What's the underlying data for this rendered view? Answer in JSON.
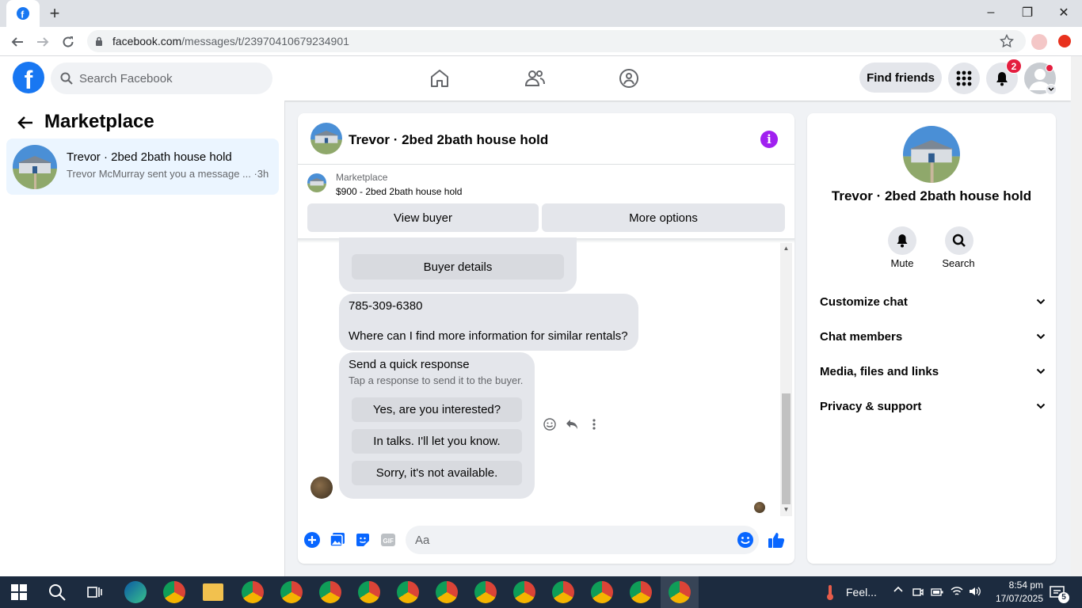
{
  "browser": {
    "url_host": "facebook.com",
    "url_path": "/messages/t/23970410679234901",
    "new_tab": "+",
    "minimize": "–",
    "maximize": "❐",
    "close": "✕"
  },
  "header": {
    "logo": "f",
    "search_placeholder": "Search Facebook",
    "find_friends": "Find friends",
    "notification_count": "2"
  },
  "sidebar": {
    "title": "Marketplace",
    "conversations": [
      {
        "title": "Trevor · 2bed 2bath house hold",
        "preview": "Trevor McMurray sent you a message ... ·3h"
      }
    ]
  },
  "chat": {
    "title": "Trevor · 2bed 2bath house hold",
    "info_icon": "i",
    "listing_label": "Marketplace",
    "listing_price": "$900 - 2bed 2bath house hold",
    "view_buyer": "View buyer",
    "more_options": "More options",
    "buyer_details": "Buyer details",
    "phone": "785-309-6380",
    "question": "Where can I find more information for similar rentals?",
    "quick_response_title": "Send a quick response",
    "quick_response_sub": "Tap a response to send it to the buyer.",
    "quick_responses": [
      "Yes, are you interested?",
      "In talks. I'll let you know.",
      "Sorry, it's not available."
    ],
    "composer_placeholder": "Aa"
  },
  "details": {
    "title": "Trevor · 2bed 2bath house hold",
    "mute": "Mute",
    "search": "Search",
    "sections": [
      "Customize chat",
      "Chat members",
      "Media, files and links",
      "Privacy & support"
    ]
  },
  "taskbar": {
    "weather": "Feel...",
    "time": "8:54 pm",
    "date": "17/07/2025",
    "notification_count": "5"
  },
  "colors": {
    "brand": "#1877f2",
    "info_purple": "#a020f0",
    "badge_red": "#e41e3f"
  }
}
